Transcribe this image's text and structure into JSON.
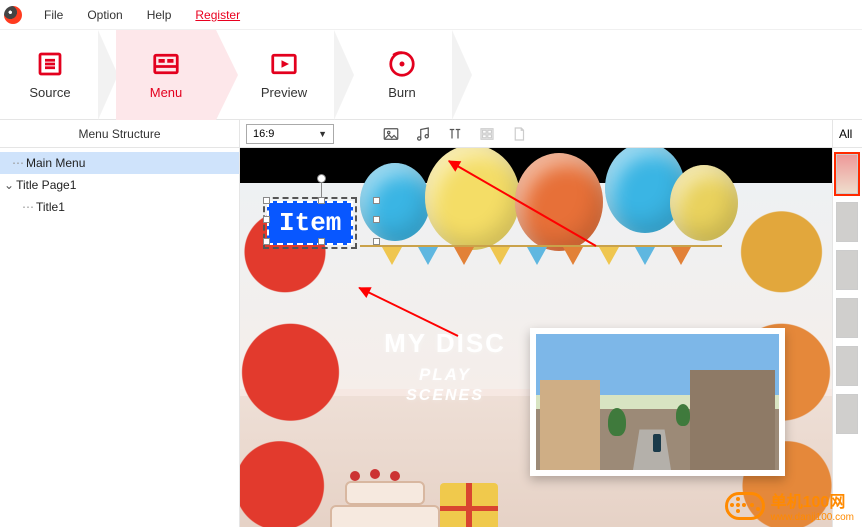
{
  "menubar": {
    "items": [
      "File",
      "Option",
      "Help",
      "Register"
    ]
  },
  "steps": {
    "source": "Source",
    "menu": "Menu",
    "preview": "Preview",
    "burn": "Burn"
  },
  "left": {
    "header": "Menu Structure",
    "tree": {
      "main": "Main Menu",
      "titlepage": "Title Page1",
      "title": "Title1"
    }
  },
  "toolbar": {
    "aspect": "16:9",
    "right_filter": "All"
  },
  "canvas": {
    "item_label": "Item",
    "disc": {
      "title": "MY DISC",
      "play": "PLAY",
      "scenes": "SCENES"
    }
  },
  "watermark": {
    "cn": "单机100网",
    "en": "www.danji100.com"
  }
}
